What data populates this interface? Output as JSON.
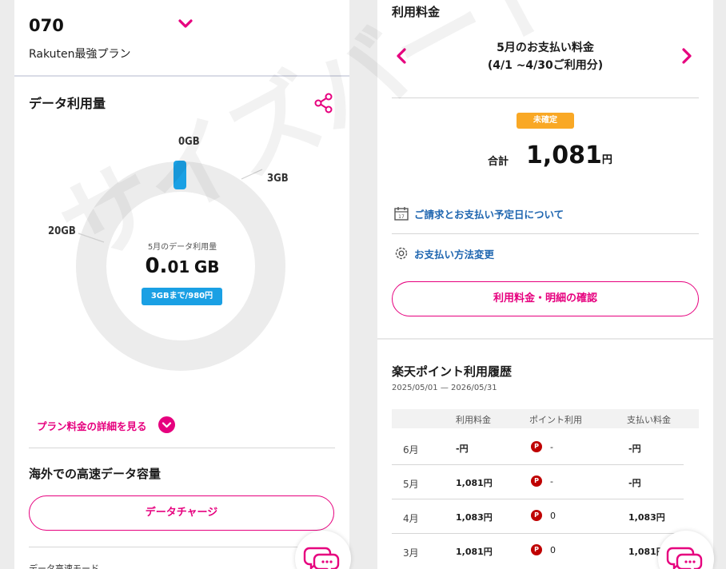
{
  "left": {
    "phone_number": "070",
    "plan_name": "Rakuten最強プラン",
    "section_title": "データ利用量",
    "donut": {
      "label_zero": "0GB",
      "label_3gb": "3GB",
      "label_20gb": "20GB",
      "caption": "5月のデータ利用量",
      "value_main": "0.",
      "value_decimal": "01",
      "value_unit": "GB",
      "usage_gb": 0.01,
      "badge": "3GBまで/980円"
    },
    "plan_detail_link": "プラン料金の詳細を見る",
    "overseas_title": "海外での高速データ容量",
    "charge_button": "データチャージ",
    "bottom_cut_text": "データ高速モード"
  },
  "right": {
    "title": "利用料金",
    "month_title_line1": "5月のお支払い料金",
    "month_title_line2": "(4/1 ~4/30ご利用分)",
    "status_badge": "未確定",
    "total_label": "合計",
    "total_amount": "1,081",
    "total_unit": "円",
    "billing_date_link": "ご請求とお支払い予定日について",
    "payment_method_link": "お支払い方法変更",
    "details_button": "利用料金・明細の確認",
    "points_title": "楽天ポイント利用履歴",
    "points_range": "2025/05/01 — 2026/05/31",
    "table": {
      "headers": [
        "利用料金",
        "ポイント利用",
        "支払い料金"
      ],
      "rows": [
        {
          "month": "6月",
          "usage": "-円",
          "points": "-",
          "paid": "-円"
        },
        {
          "month": "5月",
          "usage": "1,081円",
          "points": "-",
          "paid": "-円"
        },
        {
          "month": "4月",
          "usage": "1,083円",
          "points": "0",
          "paid": "1,083円"
        },
        {
          "month": "3月",
          "usage": "1,081円",
          "points": "0",
          "paid": "1,081円"
        }
      ]
    }
  },
  "watermark": "サイズバード",
  "colors": {
    "accent": "#e6007e",
    "link": "#1f66b0",
    "badge_blue": "#1aa0e4",
    "badge_orange": "#f9a825",
    "point_red": "#bf0000"
  }
}
